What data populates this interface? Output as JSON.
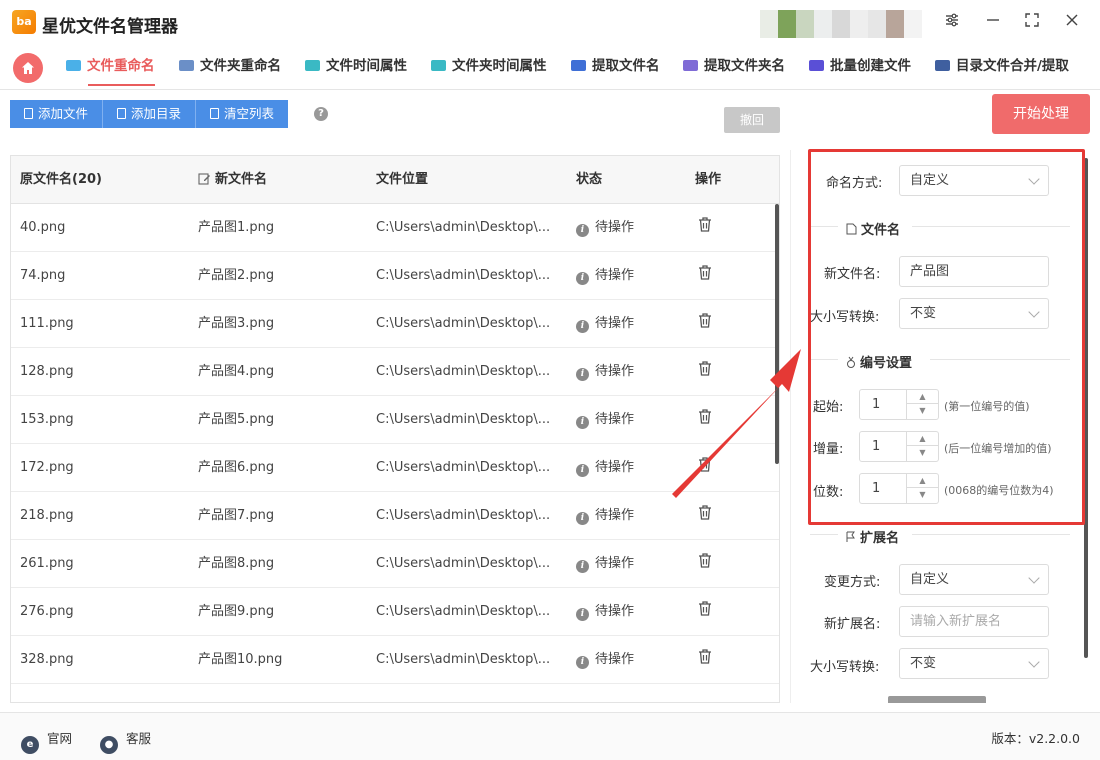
{
  "app": {
    "logo_text": "ba",
    "title": "星优文件名管理器"
  },
  "tabs": [
    {
      "label": "文件重命名",
      "color": "#4ab0e8"
    },
    {
      "label": "文件夹重命名",
      "color": "#6b8fc7"
    },
    {
      "label": "文件时间属性",
      "color": "#3ab9c4"
    },
    {
      "label": "文件夹时间属性",
      "color": "#3ab9c4"
    },
    {
      "label": "提取文件名",
      "color": "#3f6fd6"
    },
    {
      "label": "提取文件夹名",
      "color": "#7f6bd6"
    },
    {
      "label": "批量创建文件",
      "color": "#5a4fd6"
    },
    {
      "label": "目录文件合并/提取",
      "color": "#3f5f9f"
    }
  ],
  "toolbar": {
    "add_file": "添加文件",
    "add_dir": "添加目录",
    "clear_list": "清空列表",
    "help": "?",
    "undo": "撤回",
    "start": "开始处理"
  },
  "table": {
    "headers": {
      "orig": "原文件名(20)",
      "new": "新文件名",
      "location": "文件位置",
      "status": "状态",
      "action": "操作"
    },
    "rows": [
      {
        "orig": "40.png",
        "new": "产品图1.png",
        "loc": "C:\\Users\\admin\\Desktop\\...",
        "status": "待操作"
      },
      {
        "orig": "74.png",
        "new": "产品图2.png",
        "loc": "C:\\Users\\admin\\Desktop\\...",
        "status": "待操作"
      },
      {
        "orig": "111.png",
        "new": "产品图3.png",
        "loc": "C:\\Users\\admin\\Desktop\\...",
        "status": "待操作"
      },
      {
        "orig": "128.png",
        "new": "产品图4.png",
        "loc": "C:\\Users\\admin\\Desktop\\...",
        "status": "待操作"
      },
      {
        "orig": "153.png",
        "new": "产品图5.png",
        "loc": "C:\\Users\\admin\\Desktop\\...",
        "status": "待操作"
      },
      {
        "orig": "172.png",
        "new": "产品图6.png",
        "loc": "C:\\Users\\admin\\Desktop\\...",
        "status": "待操作"
      },
      {
        "orig": "218.png",
        "new": "产品图7.png",
        "loc": "C:\\Users\\admin\\Desktop\\...",
        "status": "待操作"
      },
      {
        "orig": "261.png",
        "new": "产品图8.png",
        "loc": "C:\\Users\\admin\\Desktop\\...",
        "status": "待操作"
      },
      {
        "orig": "276.png",
        "new": "产品图9.png",
        "loc": "C:\\Users\\admin\\Desktop\\...",
        "status": "待操作"
      },
      {
        "orig": "328.png",
        "new": "产品图10.png",
        "loc": "C:\\Users\\admin\\Desktop\\...",
        "status": "待操作"
      }
    ]
  },
  "panel": {
    "naming_mode_label": "命名方式:",
    "naming_mode_value": "自定义",
    "filename_section": "文件名",
    "new_name_label": "新文件名:",
    "new_name_value": "产品图",
    "case_label": "大小写转换:",
    "case_value": "不变",
    "numbering_section": "编号设置",
    "start_label": "起始:",
    "start_value": "1",
    "start_hint": "(第一位编号的值)",
    "step_label": "增量:",
    "step_value": "1",
    "step_hint": "(后一位编号增加的值)",
    "digits_label": "位数:",
    "digits_value": "1",
    "digits_hint": "(0068的编号位数为4)",
    "ext_section": "扩展名",
    "change_mode_label": "变更方式:",
    "change_mode_value": "自定义",
    "new_ext_label": "新扩展名:",
    "new_ext_placeholder": "请输入新扩展名",
    "ext_case_label": "大小写转换:",
    "ext_case_value": "不变"
  },
  "footer": {
    "website": "官网",
    "support": "客服",
    "version": "版本：v2.2.0.0"
  },
  "colors": {
    "accent_red": "#f06b6b",
    "tool_blue": "#4a8ee6",
    "annotation_red": "#e53935"
  }
}
